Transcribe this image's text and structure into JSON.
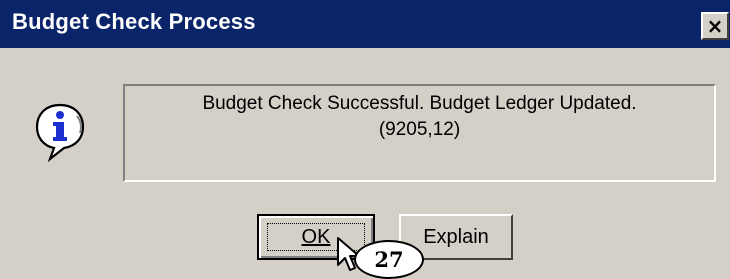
{
  "window": {
    "title": "Budget Check Process",
    "close_glyph": "×"
  },
  "message": {
    "icon": "info-icon",
    "line1": "Budget Check Successful. Budget Ledger Updated.",
    "line2": "(9205,12)"
  },
  "buttons": {
    "ok_label": "OK",
    "explain_label": "Explain"
  },
  "annotation": {
    "step_number": "27"
  },
  "colors": {
    "titlebar": "#0a246a",
    "dialog_face": "#d4d0c8",
    "icon_blue": "#1c2fd0"
  }
}
